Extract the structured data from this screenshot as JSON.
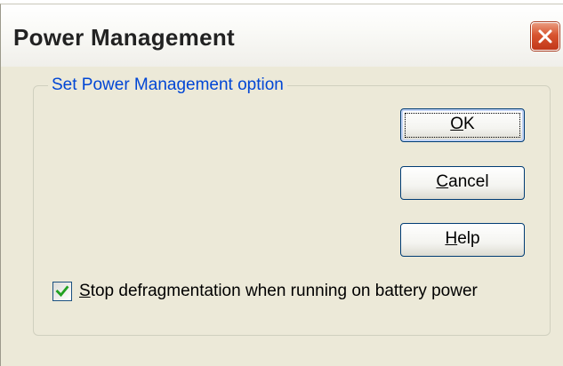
{
  "window": {
    "title": "Power Management"
  },
  "group": {
    "label": "Set Power Management option"
  },
  "buttons": {
    "ok": {
      "mnemonic": "O",
      "rest": "K"
    },
    "cancel": {
      "mnemonic": "C",
      "rest": "ancel"
    },
    "help": {
      "mnemonic": "H",
      "rest": "elp"
    }
  },
  "option": {
    "checked": true,
    "mnemonic": "S",
    "rest": "top defragmentation when running on battery power"
  },
  "colors": {
    "dialog_background": "#ece9d8",
    "group_label": "#0046d5",
    "close_button": "#d8542f",
    "check_mark": "#21a121"
  },
  "icons": {
    "close": "close-icon",
    "check": "checkmark-icon"
  }
}
